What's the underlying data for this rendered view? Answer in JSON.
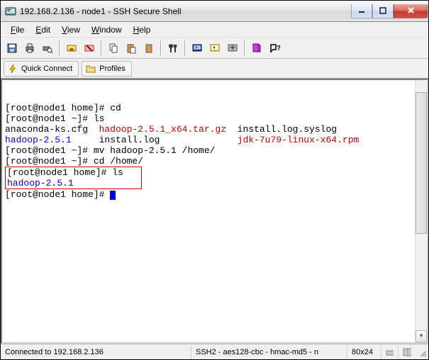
{
  "window": {
    "title": "192.168.2.136 - node1 - SSH Secure Shell"
  },
  "menu": {
    "file": "File",
    "edit": "Edit",
    "view": "View",
    "window": "Window",
    "help": "Help"
  },
  "connectbar": {
    "quick_connect": "Quick Connect",
    "profiles": "Profiles"
  },
  "terminal": {
    "lines": [
      {
        "parts": [
          {
            "t": "[root@node1 home]# cd"
          }
        ]
      },
      {
        "parts": [
          {
            "t": "[root@node1 ~]# ls"
          }
        ]
      },
      {
        "parts": [
          {
            "t": "anaconda-ks.cfg  "
          },
          {
            "t": "hadoop-2.5.1_x64.tar.gz",
            "cls": "red"
          },
          {
            "t": "  install.log.syslog"
          }
        ]
      },
      {
        "parts": [
          {
            "t": "hadoop-2.5.1",
            "cls": "blue"
          },
          {
            "t": "     install.log              "
          },
          {
            "t": "jdk-7u79-linux-x64.rpm",
            "cls": "red"
          }
        ]
      },
      {
        "parts": [
          {
            "t": "[root@node1 ~]# mv hadoop-2.5.1 /home/"
          }
        ]
      },
      {
        "parts": [
          {
            "t": "[root@node1 ~]# cd /home/"
          }
        ]
      },
      {
        "box": true,
        "parts": [
          {
            "t": "[root@node1 home]# ls"
          }
        ]
      },
      {
        "box_cont": true,
        "parts": [
          {
            "t": "hadoop-2.5.1",
            "cls": "blue"
          },
          {
            "t": "            "
          }
        ]
      },
      {
        "parts": [
          {
            "t": "[root@node1 home]# "
          },
          {
            "cursor": true
          }
        ]
      }
    ]
  },
  "status": {
    "connected": "Connected to 192.168.2.136",
    "cipher": "SSH2 - aes128-cbc - hmac-md5 - n",
    "size": "80x24"
  }
}
